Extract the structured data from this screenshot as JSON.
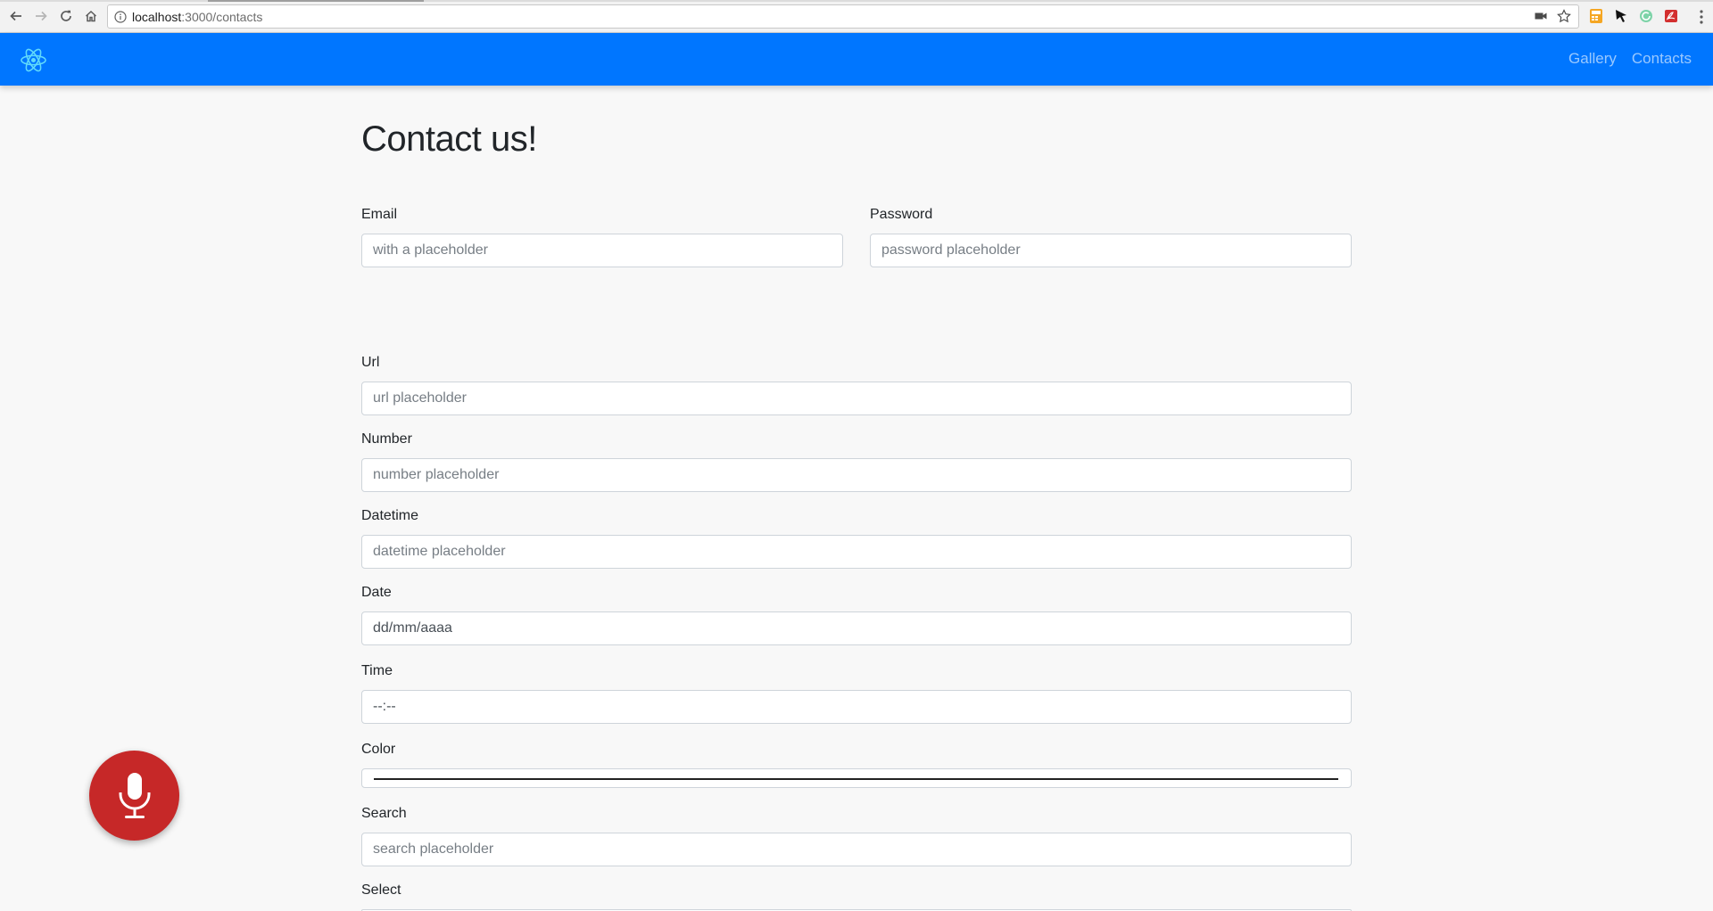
{
  "browser": {
    "url_host": "localhost",
    "url_rest": ":3000/contacts"
  },
  "icons": {
    "back": "back-arrow-icon",
    "forward": "forward-arrow-icon",
    "reload": "reload-icon",
    "home": "home-icon",
    "site_info": "info-icon",
    "camera": "camera-icon",
    "bookmark": "star-icon",
    "brand": "react-atom-icon",
    "voice": "microphone-icon"
  },
  "colors": {
    "navbar": "#0076ff",
    "mic_button": "#c62828",
    "page_bg": "#f8f8f8"
  },
  "navbar": {
    "links": [
      "Gallery",
      "Contacts"
    ]
  },
  "page": {
    "title": "Contact us!"
  },
  "form": {
    "email": {
      "label": "Email",
      "placeholder": "with a placeholder"
    },
    "password": {
      "label": "Password",
      "placeholder": "password placeholder"
    },
    "url": {
      "label": "Url",
      "placeholder": "url placeholder"
    },
    "number": {
      "label": "Number",
      "placeholder": "number placeholder"
    },
    "datetime": {
      "label": "Datetime",
      "placeholder": "datetime placeholder"
    },
    "date": {
      "label": "Date",
      "value": "dd/mm/aaaa"
    },
    "time": {
      "label": "Time",
      "value": "--:--"
    },
    "color": {
      "label": "Color"
    },
    "search": {
      "label": "Search",
      "placeholder": "search placeholder"
    },
    "select": {
      "label": "Select"
    }
  }
}
